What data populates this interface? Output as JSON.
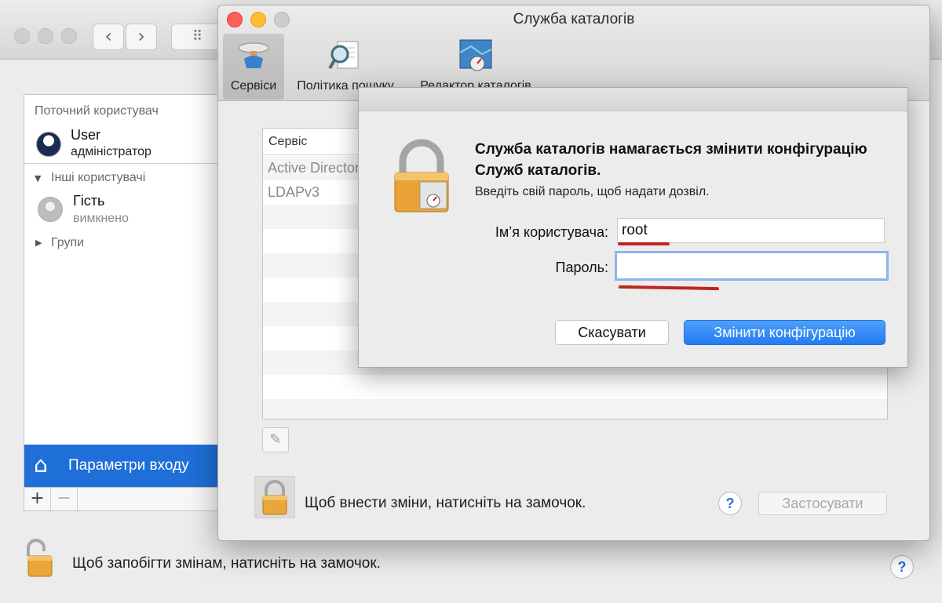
{
  "users_window": {
    "current_user_header": "Поточний користувач",
    "current_user": {
      "name": "User",
      "role": "адміністратор"
    },
    "other_users_header": "Інші користувачі",
    "other_user": {
      "name": "Гість",
      "status": "вимкнено"
    },
    "groups_label": "Групи",
    "login_options": "Параметри входу",
    "lock_text": "Щоб запобігти змінам, натисніть на замочок."
  },
  "directory_window": {
    "title": "Служба каталогів",
    "tabs": [
      "Сервіси",
      "Політика пошуку",
      "Редактор каталогів"
    ],
    "services_header": "Сервіс",
    "services": [
      "Active Directory",
      "LDAPv3"
    ],
    "lock_text": "Щоб внести зміни, натисніть на замочок.",
    "apply_label": "Застосувати"
  },
  "auth_dialog": {
    "title": "Служба каталогів намагається змінити конфігурацію Служб каталогів.",
    "subtitle": "Введіть свій пароль, щоб надати дозвіл.",
    "username_label": "Імʼя користувача:",
    "username_value": "root",
    "password_label": "Пароль:",
    "password_value": "",
    "cancel_label": "Скасувати",
    "confirm_label": "Змінити конфігурацію"
  },
  "colors": {
    "accent": "#237cf2",
    "selection": "#1f6fd8",
    "annotation": "#c0251d"
  }
}
